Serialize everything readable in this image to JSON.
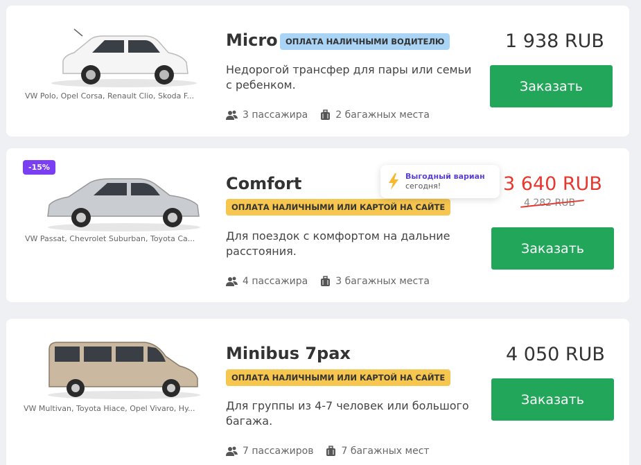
{
  "cards": [
    {
      "title": "Micro",
      "badge": "ОПЛАТА НАЛИЧНЫМИ ВОДИТЕЛЮ",
      "models": "VW Polo, Opel Corsa, Renault Clio, Skoda F...",
      "description": "Недорогой трансфер для пары или семьи с ребенком.",
      "passengers": "3 пассажира",
      "luggage": "2 багажных места",
      "price": "1 938 RUB",
      "button": "Заказать"
    },
    {
      "title": "Comfort",
      "badge": "ОПЛАТА НАЛИЧНЫМИ ИЛИ КАРТОЙ НА САЙТЕ",
      "models": "VW Passat, Chevrolet Suburban, Toyota Ca...",
      "description": "Для поездок с комфортом на дальние расстояния.",
      "passengers": "4 пассажира",
      "luggage": "3 багажных места",
      "price": "3 640 RUB",
      "old_price": "4 282 RUB",
      "discount": "-15%",
      "tooltip_line1": "Выгодный вариан",
      "tooltip_line2": "сегодня!",
      "button": "Заказать"
    },
    {
      "title": "Minibus 7pax",
      "badge": "ОПЛАТА НАЛИЧНЫМИ ИЛИ КАРТОЙ НА САЙТЕ",
      "models": "VW Multivan, Toyota Hiace, Opel Vivaro, Hy...",
      "description": "Для группы из 4-7 человек или большого багажа.",
      "passengers": "7 пассажиров",
      "luggage": "7 багажных мест",
      "price": "4 050 RUB",
      "button": "Заказать"
    }
  ],
  "colors": {
    "button_green": "#22a75a",
    "price_red": "#e8372e",
    "discount_purple": "#7a3ff2",
    "badge_blue": "#a9d4f5",
    "badge_yellow": "#f7c64e"
  },
  "icons": [
    "passengers-icon",
    "luggage-icon",
    "lightning-icon"
  ]
}
